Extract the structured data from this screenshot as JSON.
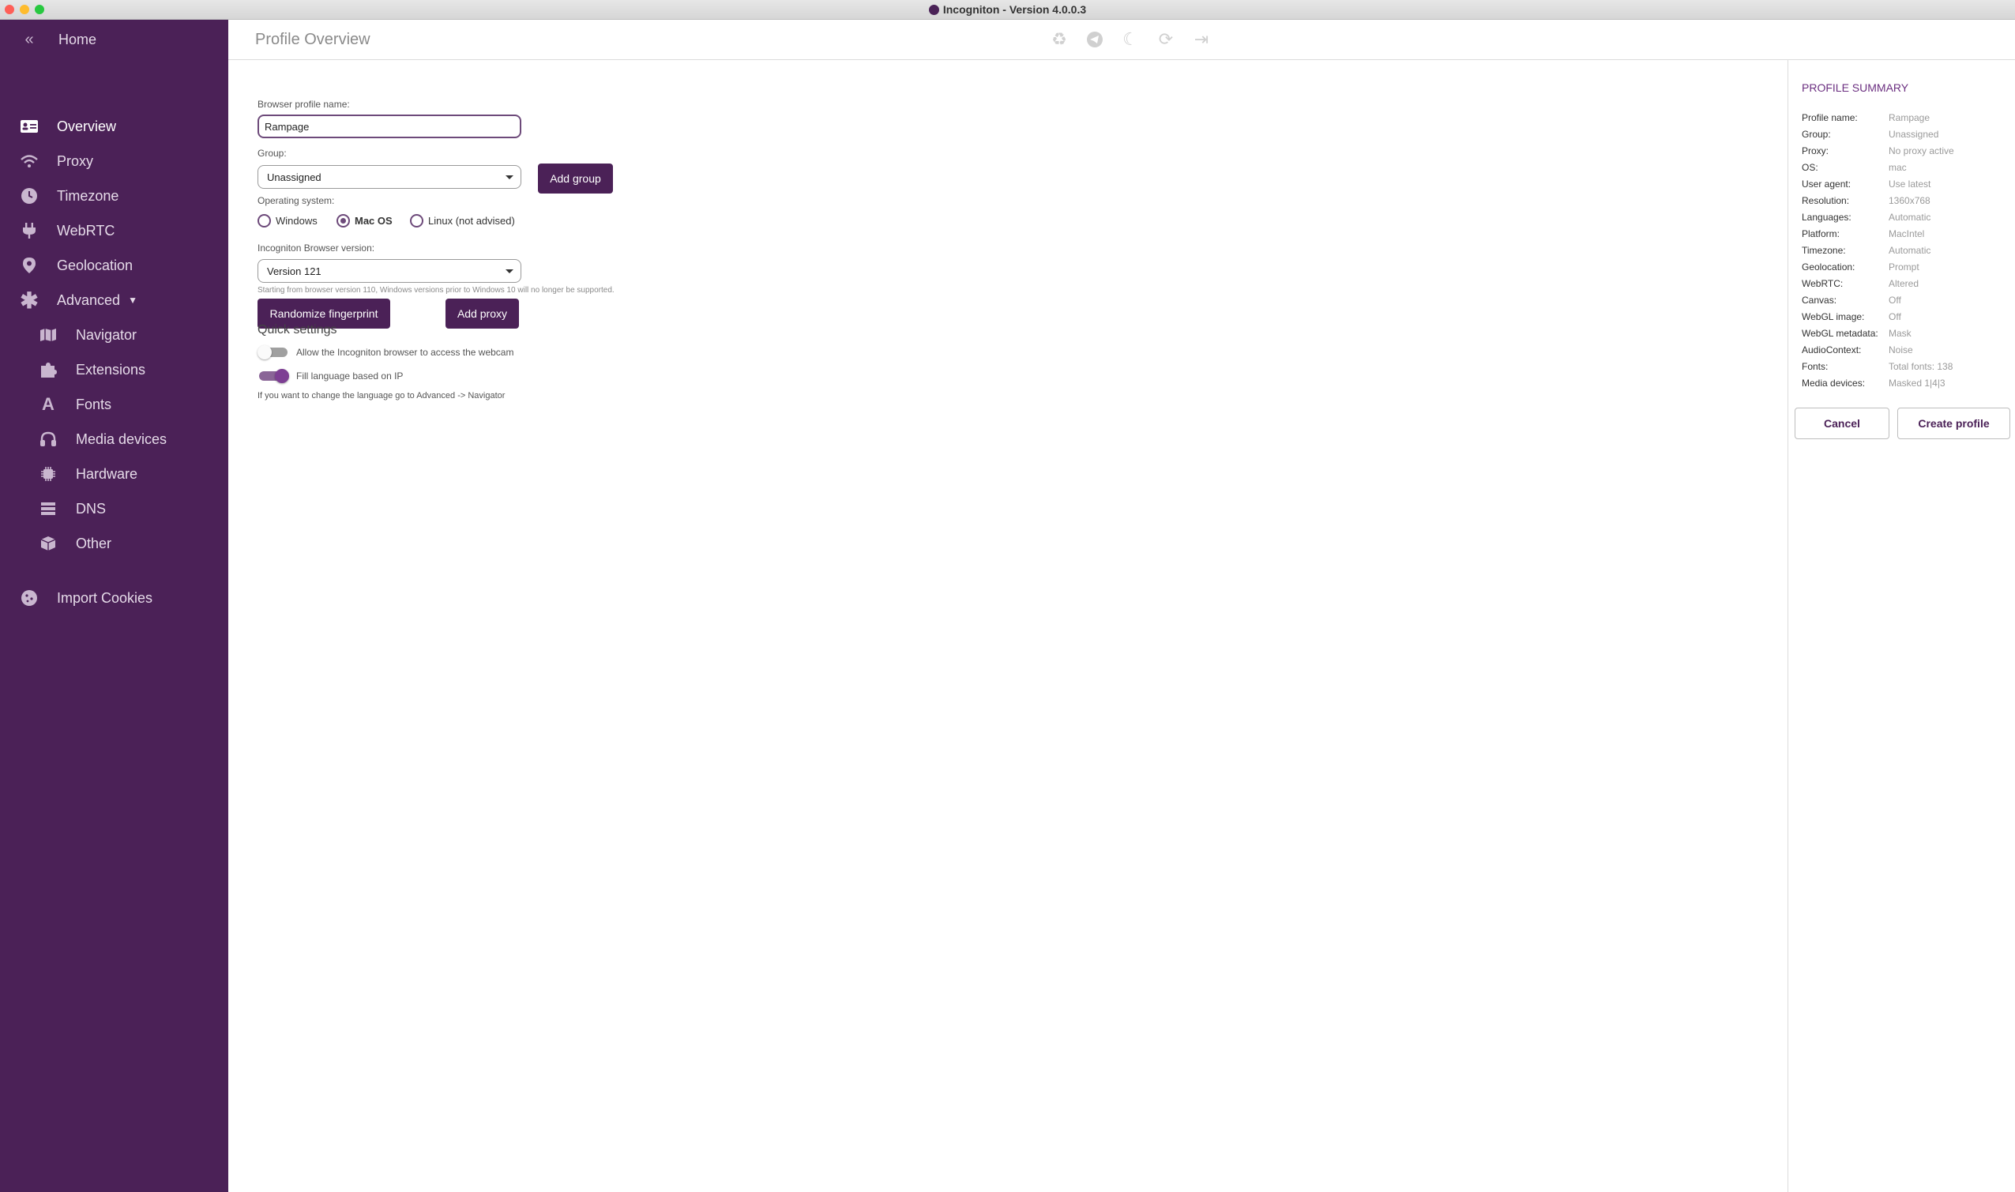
{
  "window": {
    "title": "Incogniton - Version 4.0.0.3"
  },
  "sidebar": {
    "home": {
      "label": "Home",
      "icon": "double-chevron-left-icon"
    },
    "items": [
      {
        "label": "Overview",
        "icon": "id-card-icon",
        "active": true
      },
      {
        "label": "Proxy",
        "icon": "wifi-icon"
      },
      {
        "label": "Timezone",
        "icon": "clock-icon"
      },
      {
        "label": "WebRTC",
        "icon": "plug-icon"
      },
      {
        "label": "Geolocation",
        "icon": "map-pin-icon"
      },
      {
        "label": "Advanced",
        "icon": "asterisk-icon"
      }
    ],
    "advanced_items": [
      {
        "label": "Navigator",
        "icon": "map-icon"
      },
      {
        "label": "Extensions",
        "icon": "puzzle-icon"
      },
      {
        "label": "Fonts",
        "icon": "font-icon"
      },
      {
        "label": "Media devices",
        "icon": "headphones-icon"
      },
      {
        "label": "Hardware",
        "icon": "chip-icon"
      },
      {
        "label": "DNS",
        "icon": "server-icon"
      },
      {
        "label": "Other",
        "icon": "box-icon"
      }
    ],
    "import_cookies": {
      "label": "Import Cookies",
      "icon": "cookie-icon"
    }
  },
  "header": {
    "title": "Profile Overview",
    "icons": [
      "recycle-icon",
      "telegram-icon",
      "moon-icon",
      "refresh-icon",
      "logout-icon"
    ]
  },
  "form": {
    "profile_name_label": "Browser profile name:",
    "profile_name_value": "Rampage",
    "group_label": "Group:",
    "group_value": "Unassigned",
    "add_group": "Add group",
    "os_label": "Operating system:",
    "os_options": [
      {
        "label": "Windows",
        "checked": false
      },
      {
        "label": "Mac OS",
        "checked": true
      },
      {
        "label": "Linux (not advised)",
        "checked": false
      }
    ],
    "browser_version_label": "Incogniton Browser version:",
    "browser_version_value": "Version 121",
    "version_helper": "Starting from browser version 110, Windows versions prior to Windows 10 will no longer be supported.",
    "randomize": "Randomize fingerprint",
    "add_proxy": "Add proxy"
  },
  "quick_settings": {
    "title": "Quick settings",
    "webcam_label": "Allow the Incogniton browser to access the webcam",
    "webcam_on": false,
    "language_label": "Fill language based on IP",
    "language_on": true,
    "language_helper": "If you want to change the language go to Advanced -> Navigator"
  },
  "summary": {
    "title": "PROFILE SUMMARY",
    "rows": [
      {
        "k": "Profile name:",
        "v": "Rampage"
      },
      {
        "k": "Group:",
        "v": "Unassigned"
      },
      {
        "k": "Proxy:",
        "v": "No proxy active"
      },
      {
        "k": "OS:",
        "v": "mac"
      },
      {
        "k": "User agent:",
        "v": "Use latest"
      },
      {
        "k": "Resolution:",
        "v": "1360x768"
      },
      {
        "k": "Languages:",
        "v": "Automatic"
      },
      {
        "k": "Platform:",
        "v": "MacIntel"
      },
      {
        "k": "Timezone:",
        "v": "Automatic"
      },
      {
        "k": "Geolocation:",
        "v": "Prompt"
      },
      {
        "k": "WebRTC:",
        "v": "Altered"
      },
      {
        "k": "Canvas:",
        "v": "Off"
      },
      {
        "k": "WebGL image:",
        "v": "Off"
      },
      {
        "k": "WebGL metadata:",
        "v": "Mask"
      },
      {
        "k": "AudioContext:",
        "v": "Noise"
      },
      {
        "k": "Fonts:",
        "v": "Total fonts: 138"
      },
      {
        "k": "Media devices:",
        "v": "Masked 1|4|3"
      }
    ],
    "cancel": "Cancel",
    "create": "Create profile"
  },
  "colors": {
    "sidebar": "#4b2157",
    "accent": "#6b2f80"
  }
}
